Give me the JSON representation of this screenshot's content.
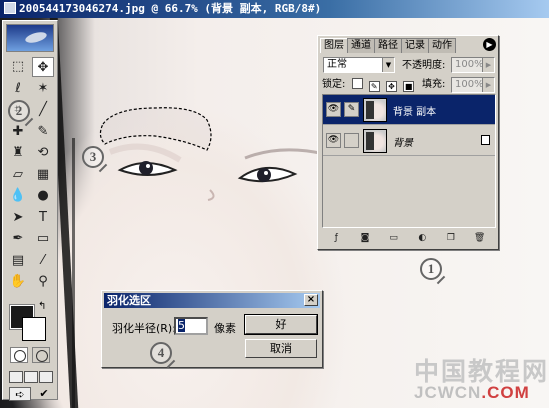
{
  "window": {
    "title": "200544173046274.jpg @ 66.7% (背景 副本, RGB/8#)"
  },
  "toolbox": {
    "tools": [
      {
        "name": "rect-marquee-tool",
        "glyph": "⬚"
      },
      {
        "name": "move-tool",
        "glyph": "✥"
      },
      {
        "name": "lasso-tool",
        "glyph": "ℓ"
      },
      {
        "name": "magic-wand-tool",
        "glyph": "✶"
      },
      {
        "name": "crop-tool",
        "glyph": "⌗"
      },
      {
        "name": "slice-tool",
        "glyph": "╱"
      },
      {
        "name": "healing-brush-tool",
        "glyph": "✚"
      },
      {
        "name": "brush-tool",
        "glyph": "✎"
      },
      {
        "name": "clone-stamp-tool",
        "glyph": "♜"
      },
      {
        "name": "history-brush-tool",
        "glyph": "⟲"
      },
      {
        "name": "eraser-tool",
        "glyph": "▱"
      },
      {
        "name": "gradient-tool",
        "glyph": "▦"
      },
      {
        "name": "blur-tool",
        "glyph": "💧"
      },
      {
        "name": "dodge-tool",
        "glyph": "●"
      },
      {
        "name": "path-select-tool",
        "glyph": "➤"
      },
      {
        "name": "type-tool",
        "glyph": "T"
      },
      {
        "name": "pen-tool",
        "glyph": "✒"
      },
      {
        "name": "shape-tool",
        "glyph": "▭"
      },
      {
        "name": "notes-tool",
        "glyph": "▤"
      },
      {
        "name": "eyedropper-tool",
        "glyph": "⁄"
      },
      {
        "name": "hand-tool",
        "glyph": "✋"
      },
      {
        "name": "zoom-tool",
        "glyph": "⚲"
      }
    ],
    "foreground_color": "#1a1a1a",
    "background_color": "#ffffff"
  },
  "layers_panel": {
    "tabs": [
      "图层",
      "通道",
      "路径",
      "记录",
      "动作"
    ],
    "blend_mode": "正常",
    "opacity_label": "不透明度:",
    "opacity_value": "100%",
    "lock_label": "锁定:",
    "fill_label": "填充:",
    "fill_value": "100%",
    "layers": [
      {
        "name": "背景 副本",
        "selected": true,
        "locked": false
      },
      {
        "name": "背景",
        "selected": false,
        "locked": true
      }
    ]
  },
  "feather_dialog": {
    "title": "羽化选区",
    "label": "羽化半径(R):",
    "value": "5",
    "unit": "像素",
    "ok_label": "好",
    "cancel_label": "取消"
  },
  "annotations": [
    "1",
    "2",
    "3",
    "4"
  ],
  "watermark": {
    "line1": "中国教程网",
    "line2_prefix": "JCWCN",
    "line2_suffix": ".COM"
  }
}
